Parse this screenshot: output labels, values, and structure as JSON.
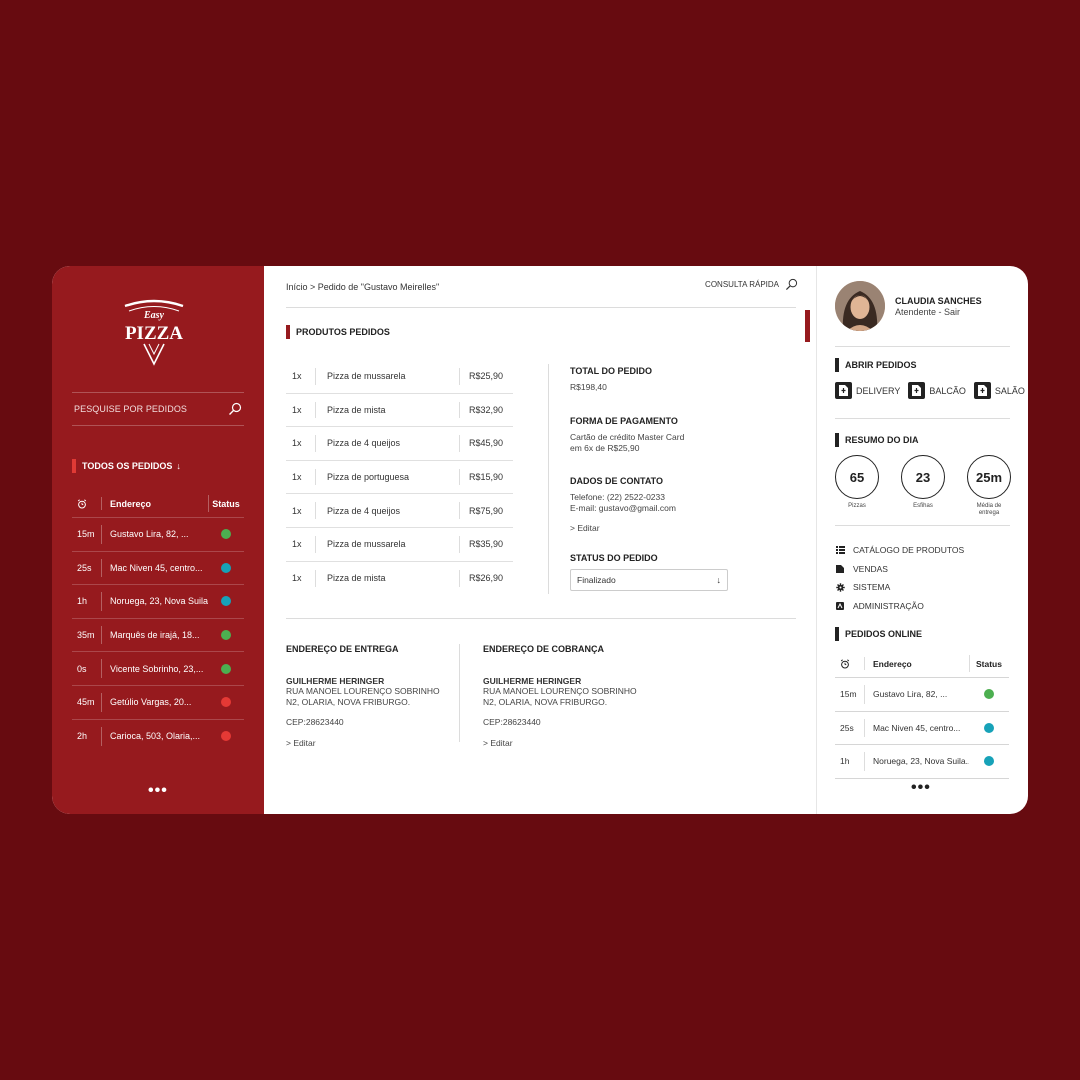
{
  "brand": {
    "logo_top": "Easy",
    "logo_main": "PIZZA"
  },
  "sidebar": {
    "search_placeholder": "PESQUISE POR PEDIDOS",
    "section_title": "TODOS OS PEDIDOS",
    "headers": {
      "address": "Endereço",
      "status": "Status"
    },
    "orders": [
      {
        "time": "15m",
        "address": "Gustavo Lira, 82, ...",
        "status_color": "#4caf50"
      },
      {
        "time": "25s",
        "address": "Mac Niven 45, centro...",
        "status_color": "#17a2b8"
      },
      {
        "time": "1h",
        "address": "Noruega, 23, Nova Suila...",
        "status_color": "#17a2b8"
      },
      {
        "time": "35m",
        "address": "Marquês de irajá, 18...",
        "status_color": "#4caf50"
      },
      {
        "time": "0s",
        "address": "Vicente Sobrinho, 23,...",
        "status_color": "#4caf50"
      },
      {
        "time": "45m",
        "address": "Getúlio Vargas, 20...",
        "status_color": "#e53935"
      },
      {
        "time": "2h",
        "address": "Carioca, 503, Olaria,...",
        "status_color": "#e53935"
      }
    ],
    "more": "•••"
  },
  "main": {
    "breadcrumb": "Início > Pedido de \"Gustavo Meirelles\"",
    "quick_search": "CONSULTA RÁPIDA",
    "products_title": "PRODUTOS PEDIDOS",
    "products": [
      {
        "qty": "1x",
        "name": "Pizza de mussarela",
        "price": "R$25,90"
      },
      {
        "qty": "1x",
        "name": "Pizza de mista",
        "price": "R$32,90"
      },
      {
        "qty": "1x",
        "name": "Pizza de 4 queijos",
        "price": "R$45,90"
      },
      {
        "qty": "1x",
        "name": "Pizza de portuguesa",
        "price": "R$15,90"
      },
      {
        "qty": "1x",
        "name": "Pizza de 4 queijos",
        "price": "R$75,90"
      },
      {
        "qty": "1x",
        "name": "Pizza de mussarela",
        "price": "R$35,90"
      },
      {
        "qty": "1x",
        "name": "Pizza de mista",
        "price": "R$26,90"
      }
    ],
    "total_title": "TOTAL DO PEDIDO",
    "total_value": "R$198,40",
    "payment_title": "FORMA DE PAGAMENTO",
    "payment_line1": "Cartão de crédito Master Card",
    "payment_line2": "em 6x de R$25,90",
    "contact_title": "DADOS DE CONTATO",
    "contact_phone": "Telefone: (22) 2522-0233",
    "contact_email": "E-mail: gustavo@gmail.com",
    "contact_edit": "> Editar",
    "status_title": "STATUS DO PEDIDO",
    "status_value": "Finalizado",
    "delivery": {
      "title": "ENDEREÇO DE ENTREGA",
      "name": "GUILHERME HERINGER",
      "line1": "RUA MANOEL LOURENÇO SOBRINHO",
      "line2": "N2, OLARIA, NOVA FRIBURGO.",
      "cep": "CEP:28623440",
      "edit": "> Editar"
    },
    "billing": {
      "title": "ENDEREÇO DE COBRANÇA",
      "name": "GUILHERME HERINGER",
      "line1": "RUA MANOEL LOURENÇO SOBRINHO",
      "line2": "N2, OLARIA, NOVA FRIBURGO.",
      "cep": "CEP:28623440",
      "edit": "> Editar"
    }
  },
  "right": {
    "user_name": "CLAUDIA SANCHES",
    "user_role": "Atendente - Sair",
    "open_title": "ABRIR PEDIDOS",
    "open_buttons": [
      "DELIVERY",
      "BALCÃO",
      "SALÃO"
    ],
    "summary_title": "RESUMO DO DIA",
    "summary": [
      {
        "value": "65",
        "label": "Pizzas"
      },
      {
        "value": "23",
        "label": "Esfihas"
      },
      {
        "value": "25m",
        "label": "Média de entrega"
      }
    ],
    "menu": [
      "CATÁLOGO DE PRODUTOS",
      "VENDAS",
      "SISTEMA",
      "ADMINISTRAÇÃO"
    ],
    "online_title": "PEDIDOS ONLINE",
    "headers": {
      "address": "Endereço",
      "status": "Status"
    },
    "orders": [
      {
        "time": "15m",
        "address": "Gustavo Lira, 82, ...",
        "status_color": "#4caf50"
      },
      {
        "time": "25s",
        "address": "Mac Niven 45, centro...",
        "status_color": "#17a2b8"
      },
      {
        "time": "1h",
        "address": "Noruega, 23, Nova Suila...",
        "status_color": "#17a2b8"
      }
    ],
    "more": "•••"
  }
}
